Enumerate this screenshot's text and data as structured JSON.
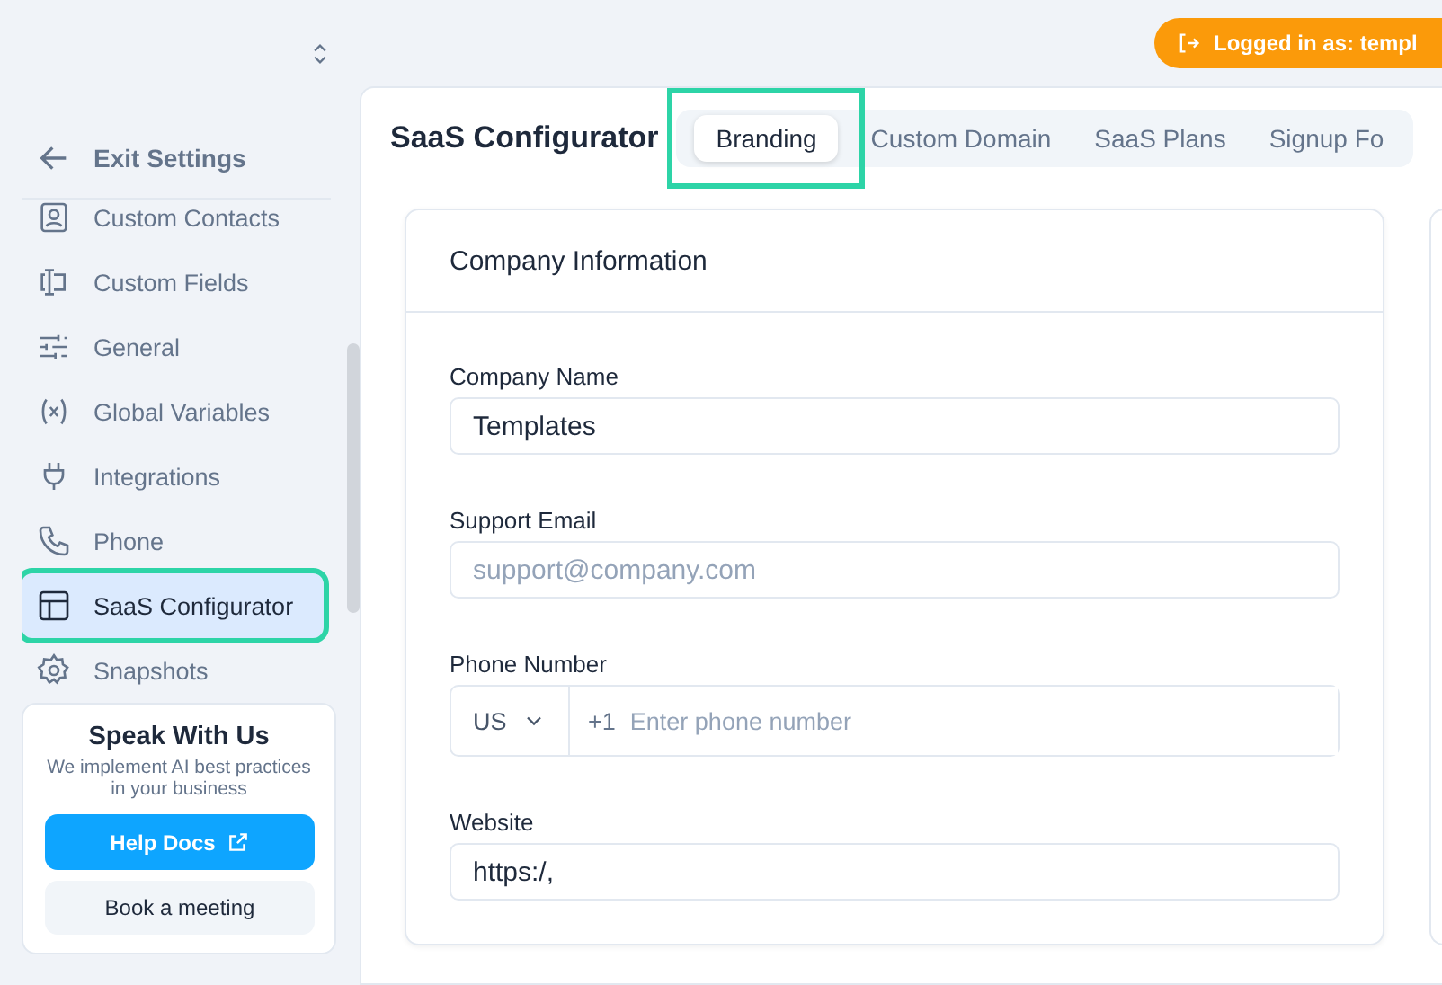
{
  "sidebar": {
    "exit_label": "Exit Settings",
    "items": [
      {
        "label": "Custom Contacts",
        "selected": false,
        "highlighted": false
      },
      {
        "label": "Custom Fields",
        "selected": false,
        "highlighted": false
      },
      {
        "label": "General",
        "selected": false,
        "highlighted": false
      },
      {
        "label": "Global Variables",
        "selected": false,
        "highlighted": false
      },
      {
        "label": "Integrations",
        "selected": false,
        "highlighted": false
      },
      {
        "label": "Phone",
        "selected": false,
        "highlighted": false
      },
      {
        "label": "SaaS Configurator",
        "selected": true,
        "highlighted": true
      },
      {
        "label": "Snapshots",
        "selected": false,
        "highlighted": false
      }
    ],
    "promo": {
      "title": "Speak With Us",
      "text": "We implement AI best practices in your business",
      "primary_button": "Help Docs",
      "secondary_button": "Book a meeting"
    }
  },
  "login_badge": "Logged in as: templ",
  "page_title": "SaaS Configurator",
  "tabs": [
    {
      "label": "Branding",
      "selected": true,
      "highlighted": true
    },
    {
      "label": "Custom Domain",
      "selected": false,
      "highlighted": false
    },
    {
      "label": "SaaS Plans",
      "selected": false,
      "highlighted": false
    },
    {
      "label": "Signup Fo",
      "selected": false,
      "highlighted": false
    }
  ],
  "card": {
    "title": "Company Information",
    "fields": [
      {
        "kind": "text",
        "label": "Company Name",
        "value": "Templates"
      },
      {
        "kind": "text",
        "label": "Support Email",
        "placeholder": "support@company.com"
      },
      {
        "kind": "phone",
        "label": "Phone Number",
        "country": "US",
        "prefix": "+1",
        "placeholder": "Enter phone number"
      },
      {
        "kind": "text",
        "label": "Website",
        "value": "https:/,"
      }
    ]
  }
}
